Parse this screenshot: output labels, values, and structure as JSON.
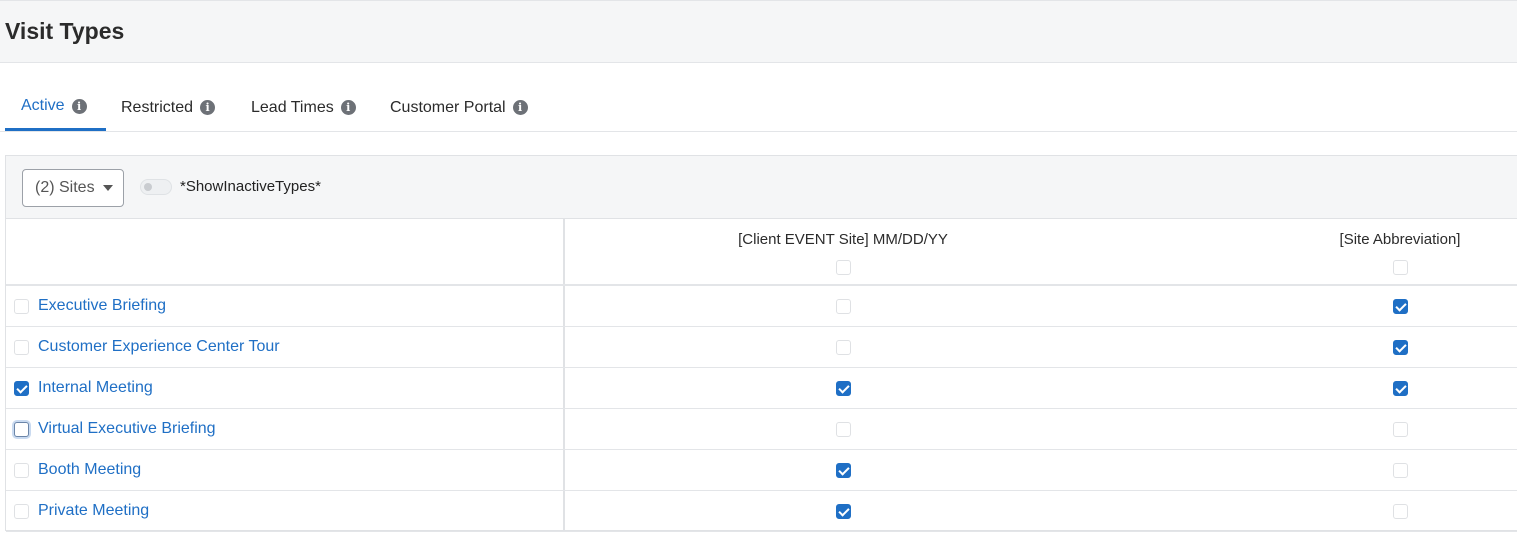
{
  "page": {
    "title": "Visit Types"
  },
  "tabs": [
    {
      "label": "Active",
      "active": true,
      "icon": "info-icon"
    },
    {
      "label": "Restricted",
      "active": false,
      "icon": "info-icon"
    },
    {
      "label": "Lead Times",
      "active": false,
      "icon": "info-icon"
    },
    {
      "label": "Customer Portal",
      "active": false,
      "icon": "info-icon"
    }
  ],
  "toolbar": {
    "sites_label": "(2) Sites",
    "show_inactive_label": "*ShowInactiveTypes*",
    "show_inactive_on": false
  },
  "columns": [
    {
      "label": "[Client EVENT Site] MM/DD/YY",
      "select_all_checked": false
    },
    {
      "label": "[Site Abbreviation]",
      "select_all_checked": false
    }
  ],
  "rows": [
    {
      "name": "Executive Briefing",
      "selected": false,
      "sites": [
        false,
        true
      ]
    },
    {
      "name": "Customer Experience Center Tour",
      "selected": false,
      "sites": [
        false,
        true
      ]
    },
    {
      "name": "Internal Meeting",
      "selected": true,
      "sites": [
        true,
        true
      ]
    },
    {
      "name": "Virtual Executive Briefing",
      "selected": false,
      "focused": true,
      "sites": [
        false,
        false
      ]
    },
    {
      "name": "Booth Meeting",
      "selected": false,
      "sites": [
        true,
        false
      ]
    },
    {
      "name": "Private Meeting",
      "selected": false,
      "sites": [
        true,
        false
      ]
    }
  ],
  "colors": {
    "accent": "#1f6fc5",
    "link": "#1f6fc5",
    "header_bg": "#f5f6f7"
  }
}
